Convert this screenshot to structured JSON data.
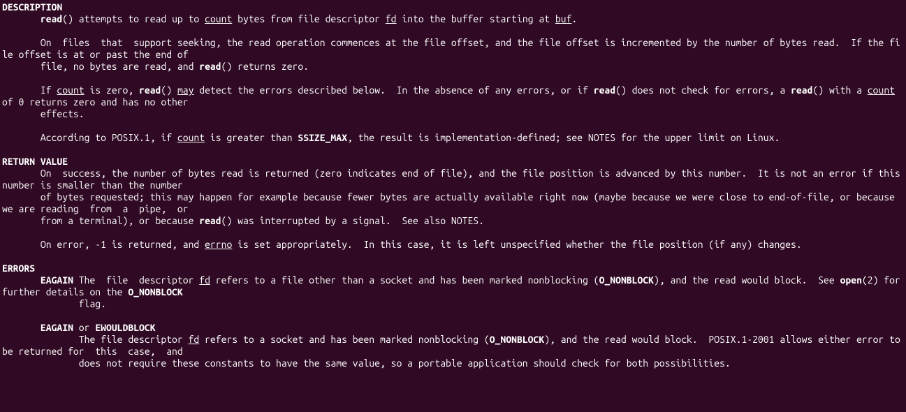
{
  "sections": {
    "description": {
      "header": "DESCRIPTION",
      "line1_pre": "       ",
      "line1_read": "read",
      "line1_mid1": "() attempts to read up to ",
      "line1_count": "count",
      "line1_mid2": " bytes from file descriptor ",
      "line1_fd": "fd",
      "line1_mid3": " into the buffer starting at ",
      "line1_buf": "buf",
      "line1_end": ".",
      "line2": "       On  files  that  support seeking, the read operation commences at the file offset, and the file offset is incremented by the number of bytes read.  If the file offset is at or past the end of",
      "line3_pre": "       file, no bytes are read, and ",
      "line3_read": "read",
      "line3_end": "() returns zero.",
      "line4_pre": "       If ",
      "line4_count": "count",
      "line4_mid1": " is zero, ",
      "line4_read": "read",
      "line4_mid2": "() ",
      "line4_may": "may",
      "line4_mid3": " detect the errors described below.  In the absence of any errors, or if ",
      "line4_read2": "read",
      "line4_mid4": "() does not check for errors, a ",
      "line4_read3": "read",
      "line4_mid5": "() with a ",
      "line4_count2": "count",
      "line4_end": " of 0 returns zero and has no other",
      "line5": "       effects.",
      "line6_pre": "       According to POSIX.1, if ",
      "line6_count": "count",
      "line6_mid1": " is greater than ",
      "line6_ssize": "SSIZE_MAX",
      "line6_end": ", the result is implementation-defined; see NOTES for the upper limit on Linux."
    },
    "return_value": {
      "header": "RETURN VALUE",
      "line1": "       On  success, the number of bytes read is returned (zero indicates end of file), and the file position is advanced by this number.  It is not an error if this number is smaller than the number",
      "line2": "       of bytes requested; this may happen for example because fewer bytes are actually available right now (maybe because we were close to end-of-file, or because we are reading  from  a  pipe,  or",
      "line3_pre": "       from a terminal), or because ",
      "line3_read": "read",
      "line3_end": "() was interrupted by a signal.  See also NOTES.",
      "line4_pre": "       On error, -1 is returned, and ",
      "line4_errno": "errno",
      "line4_end": " is set appropriately.  In this case, it is left unspecified whether the file position (if any) changes."
    },
    "errors": {
      "header": "ERRORS",
      "eagain1_pre": "       ",
      "eagain1_tag": "EAGAIN",
      "eagain1_mid1": " The  file  descriptor ",
      "eagain1_fd": "fd",
      "eagain1_mid2": " refers to a file other than a socket and has been marked nonblocking (",
      "eagain1_ononblock": "O_NONBLOCK",
      "eagain1_mid3": "), and the read would block.  See ",
      "eagain1_open": "open",
      "eagain1_mid4": "(2) for further details on the ",
      "eagain1_ononblock2": "O_NONBLOCK",
      "eagain1_flag": "              flag.",
      "eagain2_pre": "       ",
      "eagain2_tag1": "EAGAIN",
      "eagain2_or": " or ",
      "eagain2_tag2": "EWOULDBLOCK",
      "eagain2_l1_pre": "              The file descriptor ",
      "eagain2_fd": "fd",
      "eagain2_l1_mid1": " refers to a socket and has been marked nonblocking (",
      "eagain2_ononblock": "O_NONBLOCK",
      "eagain2_l1_end": "), and the read would block.  POSIX.1-2001 allows either error to be returned for  this  case,  and",
      "eagain2_l2": "              does not require these constants to have the same value, so a portable application should check for both possibilities."
    }
  }
}
